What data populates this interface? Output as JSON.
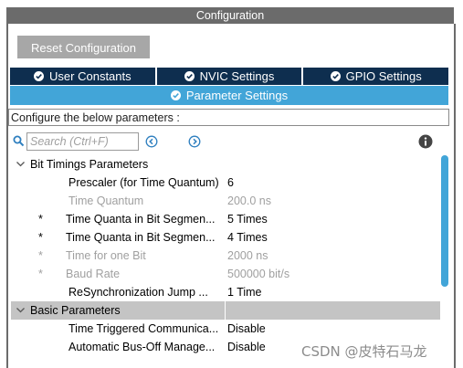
{
  "window": {
    "title": "Configuration"
  },
  "toolbar": {
    "reset_label": "Reset Configuration"
  },
  "tabs": [
    {
      "label": "User Constants",
      "active": false
    },
    {
      "label": "NVIC Settings",
      "active": false
    },
    {
      "label": "GPIO Settings",
      "active": false
    },
    {
      "label": "Parameter Settings",
      "active": true
    }
  ],
  "description": "Configure the below parameters :",
  "search": {
    "placeholder": "Search (Ctrl+F)",
    "value": ""
  },
  "groups": [
    {
      "label": "Bit Timings Parameters",
      "expanded": true,
      "params": [
        {
          "star": "",
          "name": "Prescaler (for Time Quantum)",
          "value": "6",
          "disabled": false
        },
        {
          "star": "",
          "name": "Time Quantum",
          "value": "200.0 ns",
          "disabled": true
        },
        {
          "star": "*",
          "name": "Time Quanta in Bit Segmen...",
          "value": "5 Times",
          "disabled": false
        },
        {
          "star": "*",
          "name": "Time Quanta in Bit Segmen...",
          "value": "4 Times",
          "disabled": false
        },
        {
          "star": "*",
          "name": "Time for one Bit",
          "value": "2000 ns",
          "disabled": true
        },
        {
          "star": "*",
          "name": "Baud Rate",
          "value": "500000 bit/s",
          "disabled": true
        },
        {
          "star": "",
          "name": "ReSynchronization Jump ...",
          "value": "1 Time",
          "disabled": false
        }
      ]
    },
    {
      "label": "Basic Parameters",
      "expanded": true,
      "params": [
        {
          "star": "",
          "name": "Time Triggered Communica...",
          "value": "Disable",
          "disabled": false
        },
        {
          "star": "",
          "name": "Automatic Bus-Off Manage...",
          "value": "Disable",
          "disabled": false
        }
      ]
    }
  ],
  "watermark": "CSDN @皮特石马龙",
  "colors": {
    "title_bg": "#6b6b6b",
    "tab_dark": "#0e2e4f",
    "tab_active": "#42a5d8",
    "accent": "#42a5d8"
  }
}
